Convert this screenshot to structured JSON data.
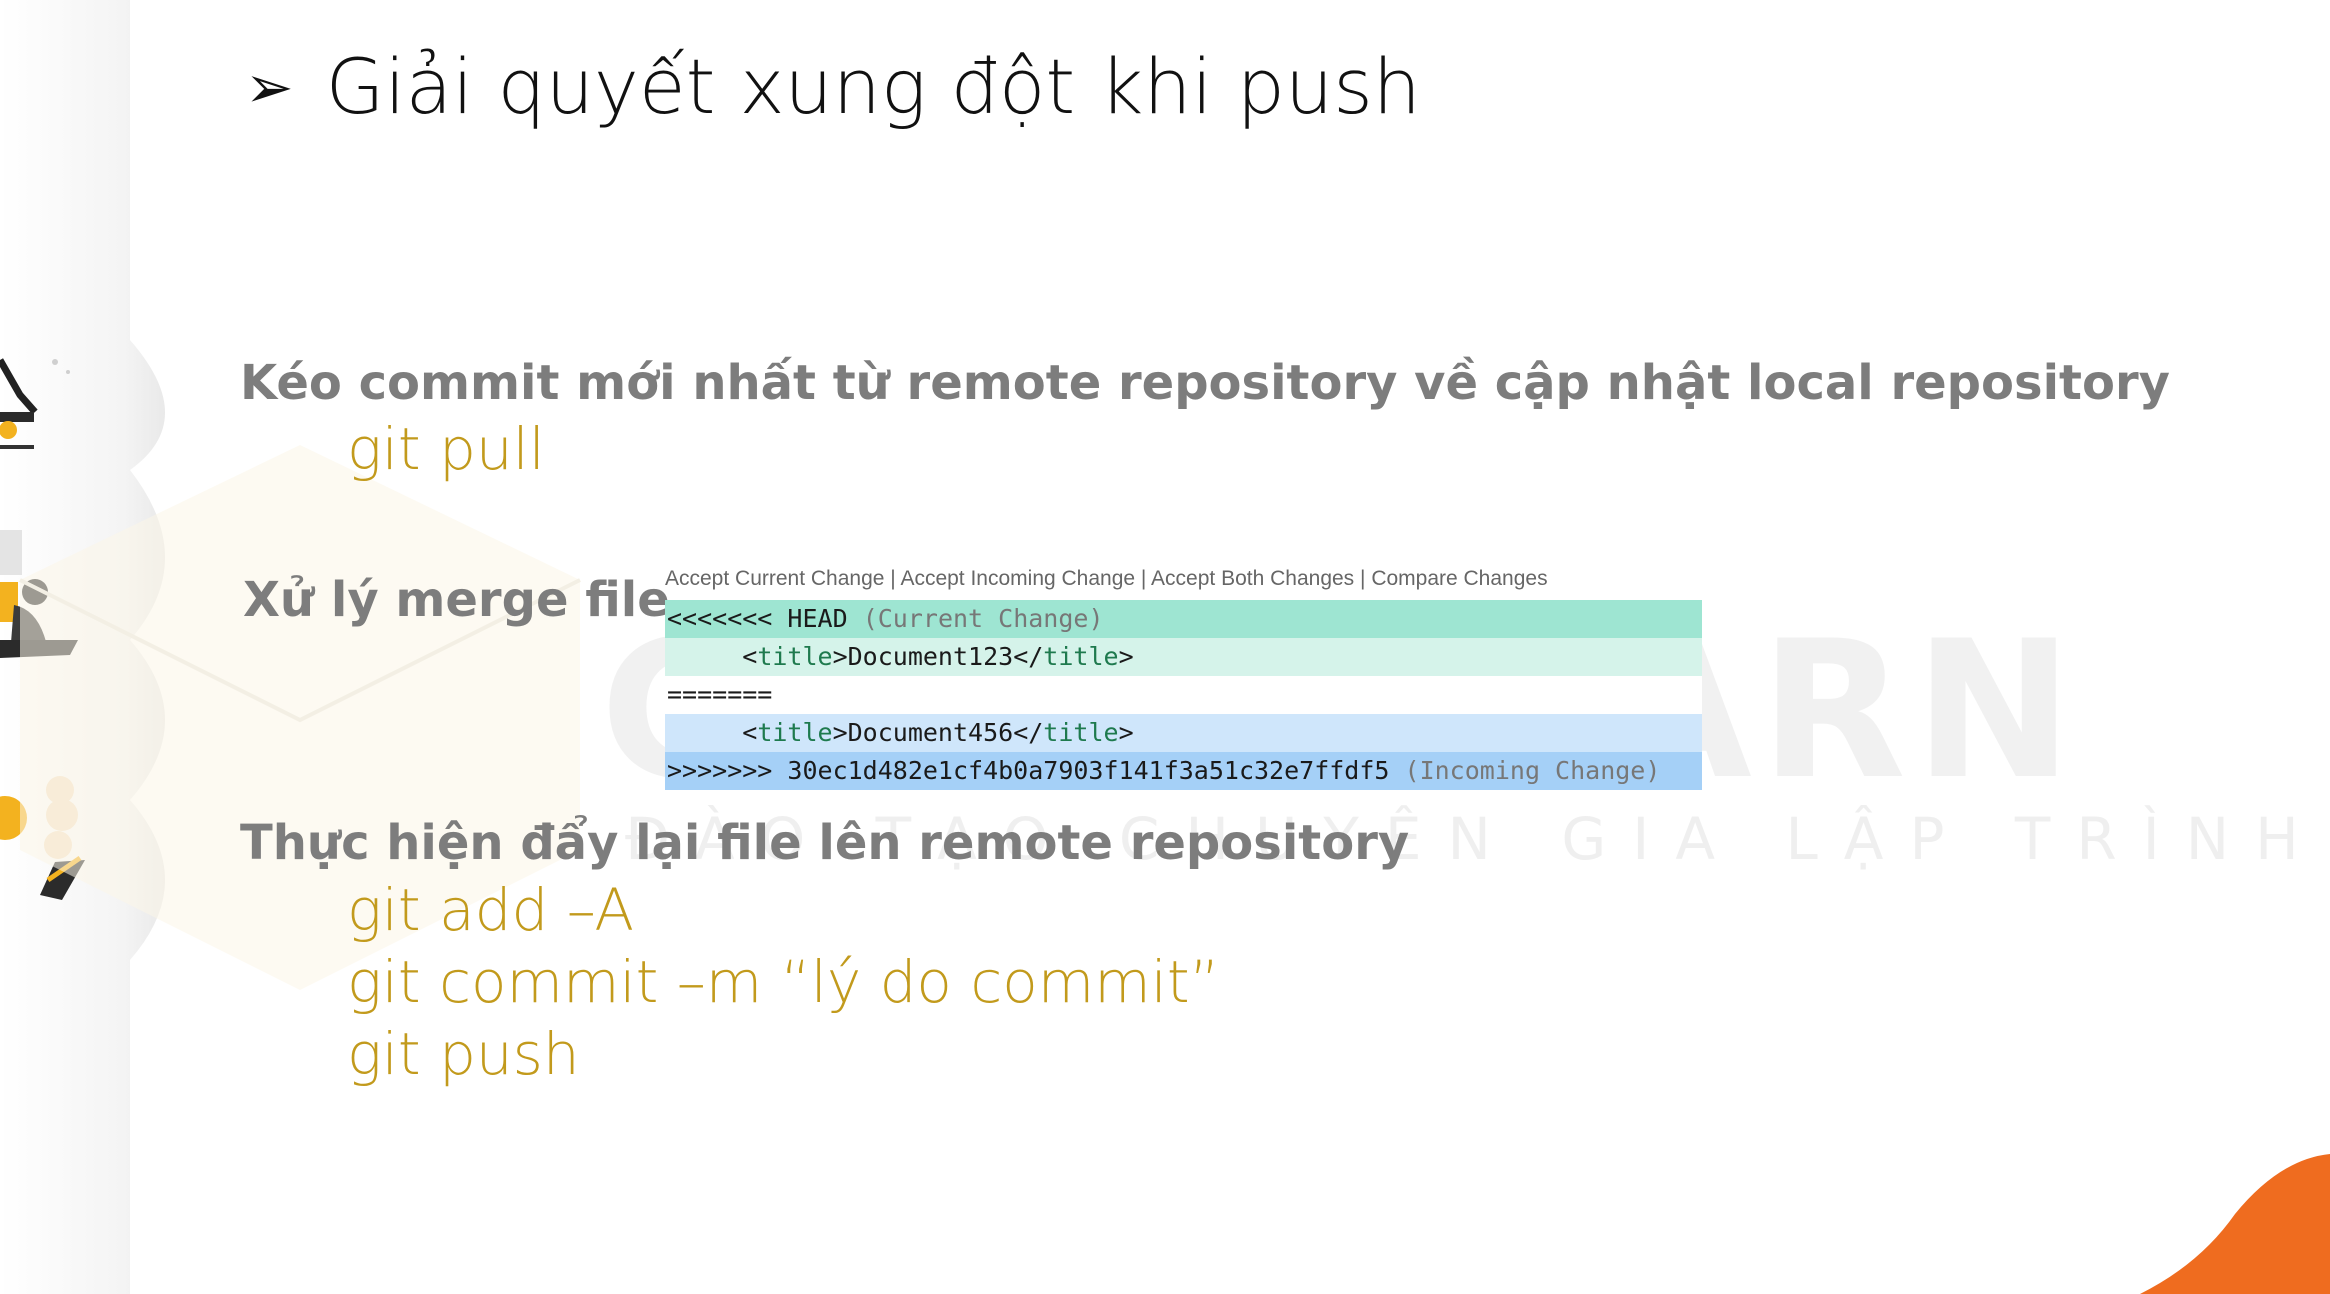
{
  "slide": {
    "title": "Giải quyết xung đột khi push",
    "bullet": "➢",
    "watermark": "CYBERLEARN",
    "watermark_sub": "ĐÀO TẠO CHUYÊN GIA LẬP TRÌNH",
    "section1": {
      "heading": "Kéo commit mới nhất từ remote repository về cập nhật local repository",
      "commands": [
        "git pull"
      ]
    },
    "section2": {
      "heading": "Xử lý merge file",
      "codelens": {
        "accept_current": "Accept Current Change",
        "accept_incoming": "Accept Incoming Change",
        "accept_both": "Accept Both Changes",
        "compare": "Compare Changes",
        "separator": " | "
      },
      "conflict": {
        "head_marker": "<<<<<<< HEAD",
        "head_note": "(Current Change)",
        "current_indent": "     <",
        "current_tag_open": "title",
        "current_text": ">Document123</",
        "current_tag_close": "title",
        "current_end": ">",
        "separator": "=======",
        "incoming_indent": "     <",
        "incoming_tag_open": "title",
        "incoming_text": ">Document456</",
        "incoming_tag_close": "title",
        "incoming_end": ">",
        "tail_marker": ">>>>>>> 30ec1d482e1cf4b0a7903f141f3a51c32e7ffdf5",
        "tail_note": "(Incoming Change)"
      }
    },
    "section3": {
      "heading": "Thực hiện đẩy lại file lên remote repository",
      "commands": [
        "git add –A",
        "git commit –m “lý do commit”",
        "git push"
      ]
    }
  },
  "colors": {
    "heading": "#7d7d7d",
    "command": "#c29a1c",
    "current_header": "#9ee5d2",
    "current_body": "#d5f3ea",
    "incoming_body": "#cfe6fb",
    "incoming_header": "#a5d0f7",
    "accent_orange": "#ef6c1f"
  }
}
